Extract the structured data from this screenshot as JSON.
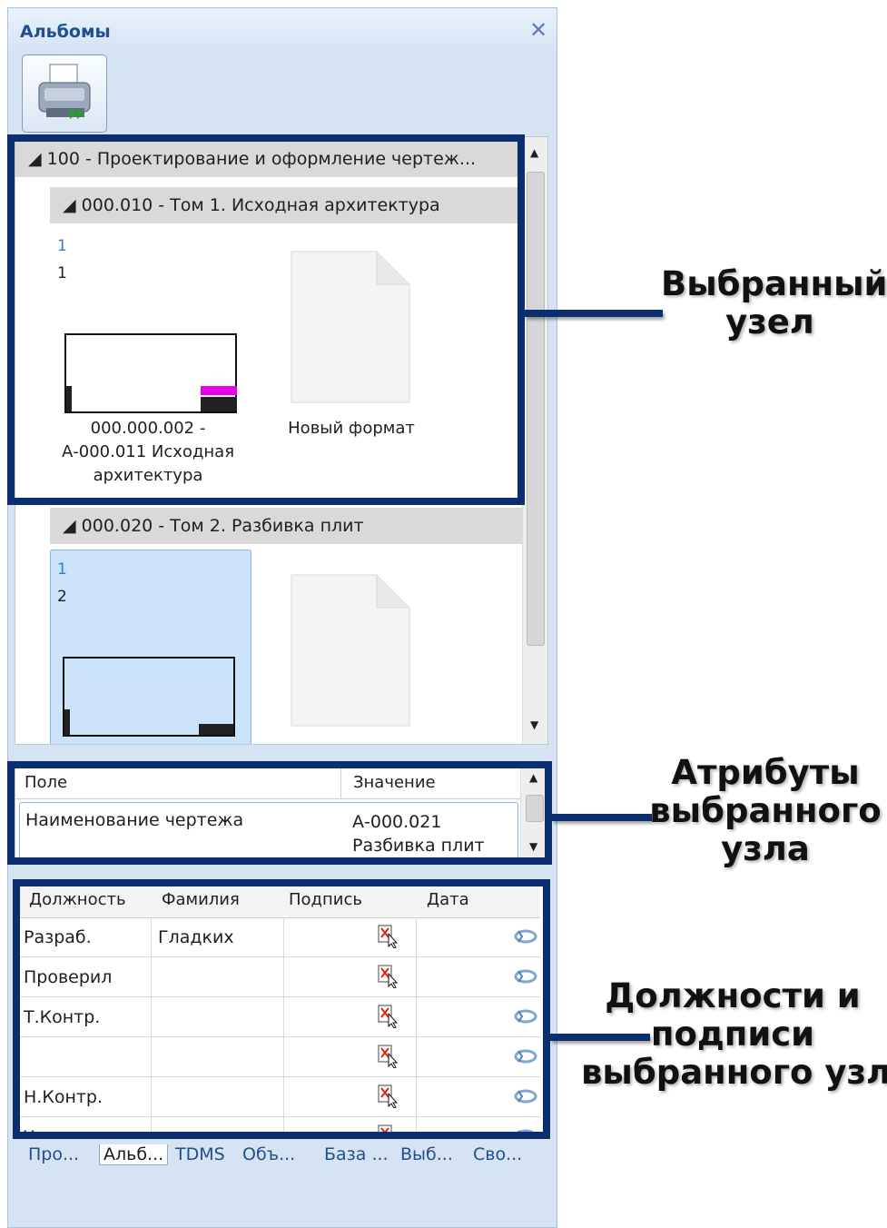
{
  "panel": {
    "title": "Альбомы",
    "close_icon": "close-icon"
  },
  "toolbar": {
    "print_icon": "printer-icon"
  },
  "tree": {
    "root_label": "100 - Проектирование  и оформление чертеж...",
    "group1": {
      "label": "000.010 - Том 1. Исходная архитектура",
      "sheet_num_a": "1",
      "sheet_num_b": "1",
      "caption1": "000.000.002 -",
      "caption2": "А-000.011 Исходная",
      "caption3": "архитектура",
      "new_format": "Новый формат"
    },
    "group2": {
      "label": "000.020 - Том 2. Разбивка плит",
      "sheet_num_a": "1",
      "sheet_num_b": "2"
    }
  },
  "attributes": {
    "col_field": "Поле",
    "col_value": "Значение",
    "row_field": "Наименование чертежа",
    "row_value_1": "А-000.021",
    "row_value_2": "Разбивка плит"
  },
  "signatures": {
    "headers": {
      "position": "Должность",
      "surname": "Фамилия",
      "signature": "Подпись",
      "date": "Дата"
    },
    "rows": [
      {
        "position": "Разраб.",
        "surname": "Гладких"
      },
      {
        "position": "Проверил",
        "surname": ""
      },
      {
        "position": "Т.Контр.",
        "surname": ""
      },
      {
        "position": "",
        "surname": ""
      },
      {
        "position": "Н.Контр.",
        "surname": ""
      },
      {
        "position": "Утв.",
        "surname": ""
      }
    ]
  },
  "tabs": [
    "Про...",
    "Альб...",
    "TDMS",
    "Объ...",
    "База ...",
    "Выб...",
    "Сво..."
  ],
  "annotations": {
    "selected_node_1": "Выбранный",
    "selected_node_2": "узел",
    "attrs_1": "Атрибуты",
    "attrs_2": "выбранного",
    "attrs_3": "узла",
    "positions_1": "Должности и",
    "positions_2": "подписи",
    "positions_3": "выбранного узла"
  },
  "colors": {
    "accent": "#1f4f8f",
    "annotation_frame": "#0b2f6e",
    "selection": "#cce4fb",
    "magenta_mark": "#e800e8"
  }
}
